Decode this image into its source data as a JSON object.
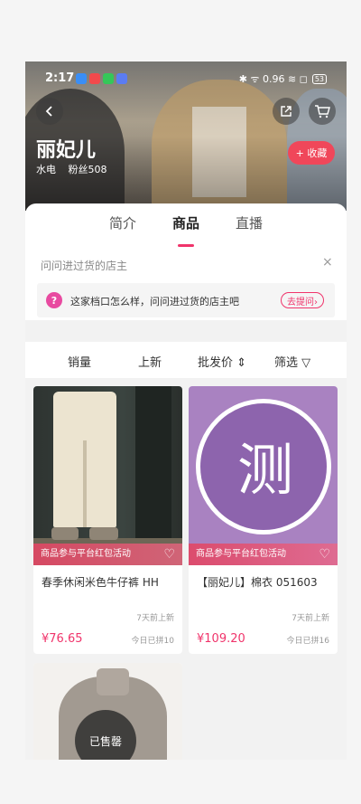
{
  "status": {
    "time": "2:17",
    "icons": "✱ ᯤ 0.96 ≋ ◻",
    "battery": "53"
  },
  "shop": {
    "name": "丽妃儿",
    "location": "水电",
    "fans": "粉丝508",
    "follow_label": "+ 收藏"
  },
  "tabs": {
    "intro": "简介",
    "goods": "商品",
    "live": "直播"
  },
  "ask": {
    "title": "问问进过货的店主",
    "close": "×",
    "icon": "?",
    "text": "这家档口怎么样，问问进过货的店主吧",
    "button": "去提问›"
  },
  "sort": {
    "sales": "销量",
    "new": "上新",
    "price": "批发价 ⇕",
    "filter": "筛选 ▽"
  },
  "products": [
    {
      "title": "春季休闲米色牛仔裤 HH",
      "promo": "商品参与平台红包活动",
      "time_ago": "7天前上新",
      "price": "¥76.65",
      "sold": "今日已拼10"
    },
    {
      "title": "【丽妃儿】棉衣 051603",
      "promo": "商品参与平台红包活动",
      "time_ago": "7天前上新",
      "price": "¥109.20",
      "sold": "今日已拼16",
      "image_text": "测"
    },
    {
      "sold_badge": "已售罄"
    }
  ],
  "colors": {
    "accent": "#f0346b",
    "follow": "#f0475a"
  }
}
